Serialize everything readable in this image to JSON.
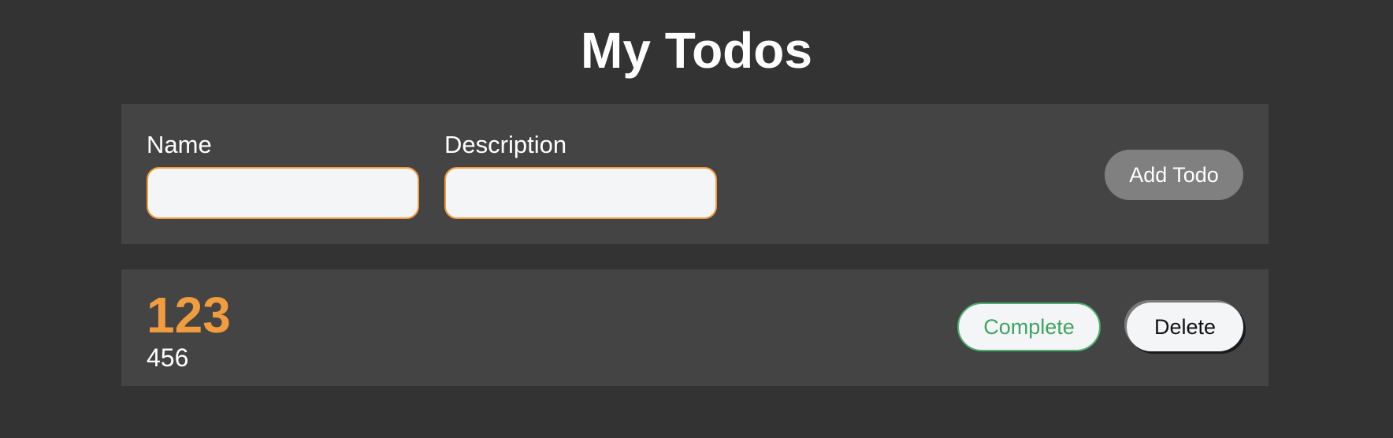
{
  "header": {
    "title": "My Todos"
  },
  "form": {
    "name_label": "Name",
    "name_value": "",
    "name_placeholder": "",
    "description_label": "Description",
    "description_value": "",
    "description_placeholder": "",
    "add_button_label": "Add Todo"
  },
  "todos": [
    {
      "name": "123",
      "description": "456",
      "complete_label": "Complete",
      "delete_label": "Delete"
    }
  ],
  "colors": {
    "background": "#333333",
    "panel": "#444444",
    "accent": "#f19c3e",
    "success": "#3fa462",
    "button_gray": "#808080",
    "input_bg": "#f4f5f7"
  }
}
